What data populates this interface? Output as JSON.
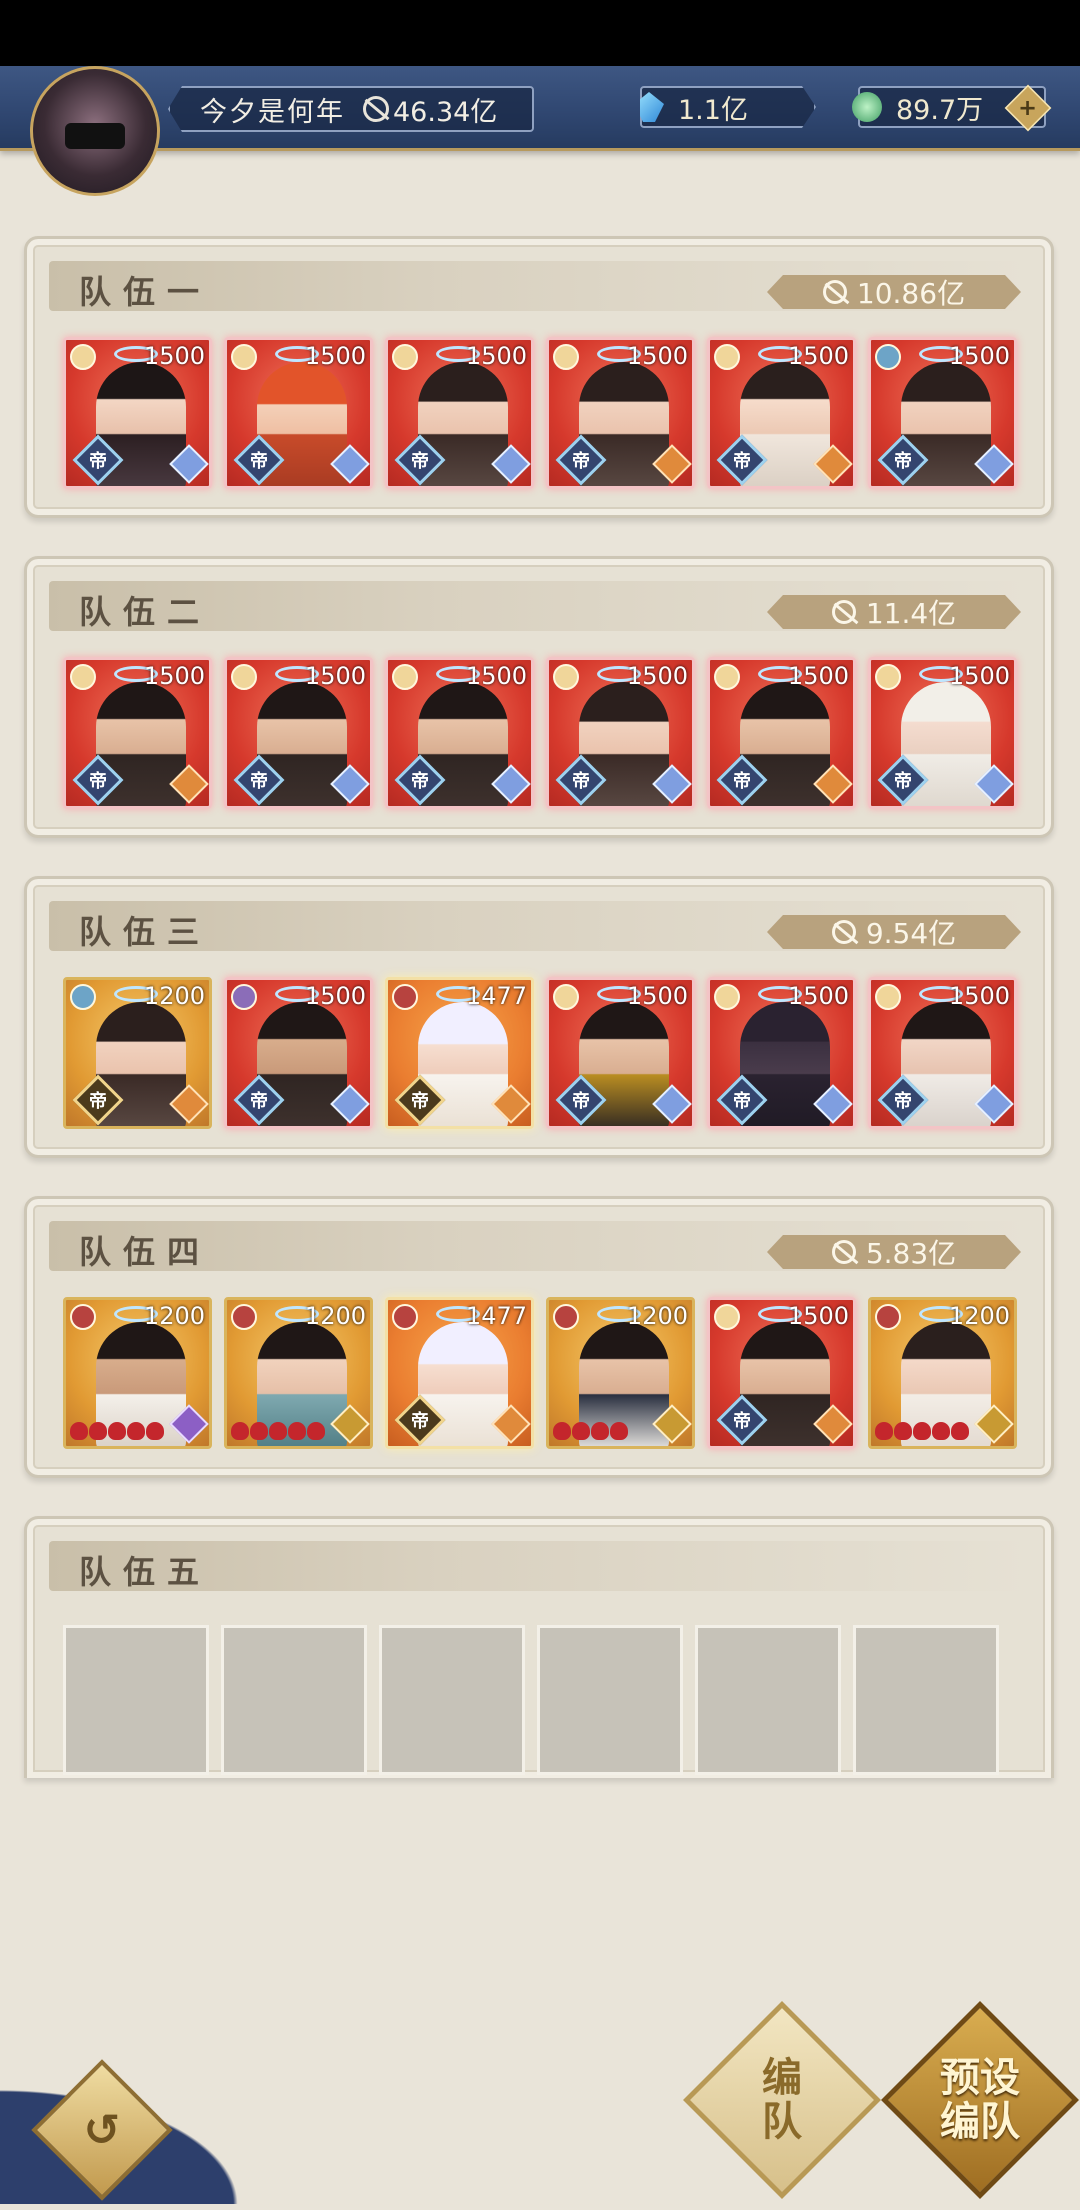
{
  "player": {
    "name": "今夕是何年",
    "power": "46.34亿"
  },
  "currencies": {
    "crystal": "1.1亿",
    "jade": "89.7万",
    "add_label": "+"
  },
  "teams": [
    {
      "title": "队伍一",
      "power": "10.86亿",
      "members": [
        {
          "level": "1500"
        },
        {
          "level": "1500"
        },
        {
          "level": "1500"
        },
        {
          "level": "1500"
        },
        {
          "level": "1500"
        },
        {
          "level": "1500"
        }
      ]
    },
    {
      "title": "队伍二",
      "power": "11.4亿",
      "members": [
        {
          "level": "1500"
        },
        {
          "level": "1500"
        },
        {
          "level": "1500"
        },
        {
          "level": "1500"
        },
        {
          "level": "1500"
        },
        {
          "level": "1500"
        }
      ]
    },
    {
      "title": "队伍三",
      "power": "9.54亿",
      "members": [
        {
          "level": "1200"
        },
        {
          "level": "1500"
        },
        {
          "level": "1477"
        },
        {
          "level": "1500"
        },
        {
          "level": "1500"
        },
        {
          "level": "1500"
        }
      ]
    },
    {
      "title": "队伍四",
      "power": "5.83亿",
      "members": [
        {
          "level": "1200"
        },
        {
          "level": "1200"
        },
        {
          "level": "1477"
        },
        {
          "level": "1200"
        },
        {
          "level": "1500"
        },
        {
          "level": "1200"
        }
      ]
    },
    {
      "title": "队伍五",
      "power": "",
      "members": []
    }
  ],
  "badges": {
    "emperor": "帝"
  },
  "buttons": {
    "back": "↺",
    "edit_team": "编\n队",
    "preset_team": "预设\n编队"
  }
}
